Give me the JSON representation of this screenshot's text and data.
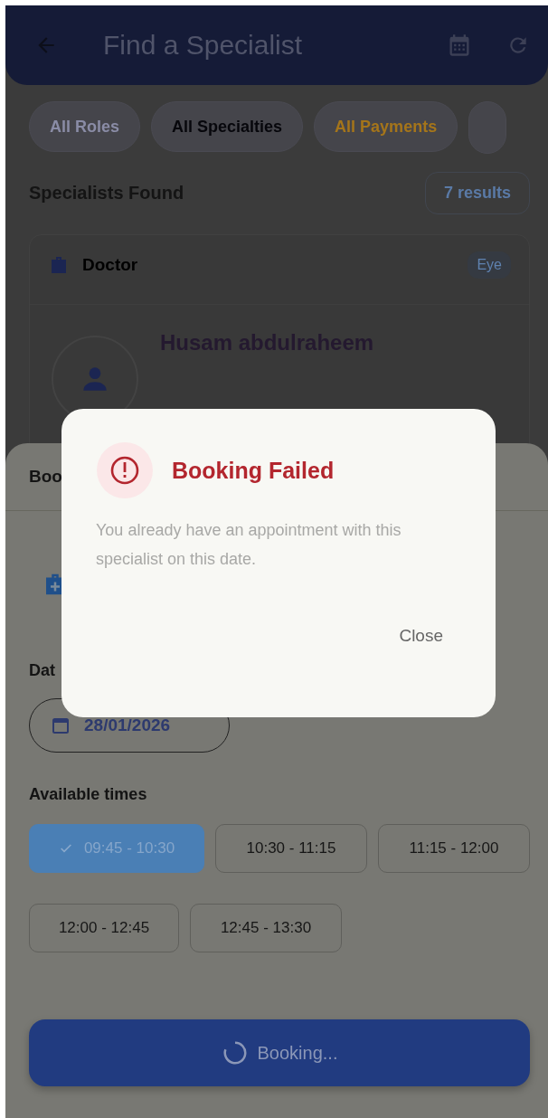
{
  "header": {
    "title": "Find a Specialist"
  },
  "filters": [
    {
      "label": "All Roles",
      "color": "#8a8ca6"
    },
    {
      "label": "All Specialties",
      "color": "#07070c"
    },
    {
      "label": "All Payments",
      "color": "#a5751a"
    }
  ],
  "results": {
    "heading": "Specialists Found",
    "count": "7 results"
  },
  "specialist_card": {
    "role": "Doctor",
    "tag": "Eye",
    "name": "Husam abdulraheem"
  },
  "booking_sheet": {
    "title": "Boo",
    "date_label": "Dat",
    "date": "28/01/2026",
    "times_label": "Available times",
    "times": [
      {
        "label": "09:45 - 10:30",
        "selected": true
      },
      {
        "label": "10:30 - 11:15",
        "selected": false
      },
      {
        "label": "11:15 - 12:00",
        "selected": false
      },
      {
        "label": "12:00 - 12:45",
        "selected": false
      },
      {
        "label": "12:45 - 13:30",
        "selected": false
      }
    ],
    "book_button": {
      "label": "Booking...",
      "loading": true
    }
  },
  "dialog": {
    "title": "Booking Failed",
    "message": "You already have an appointment with this specialist on this date.",
    "button": "Close"
  }
}
